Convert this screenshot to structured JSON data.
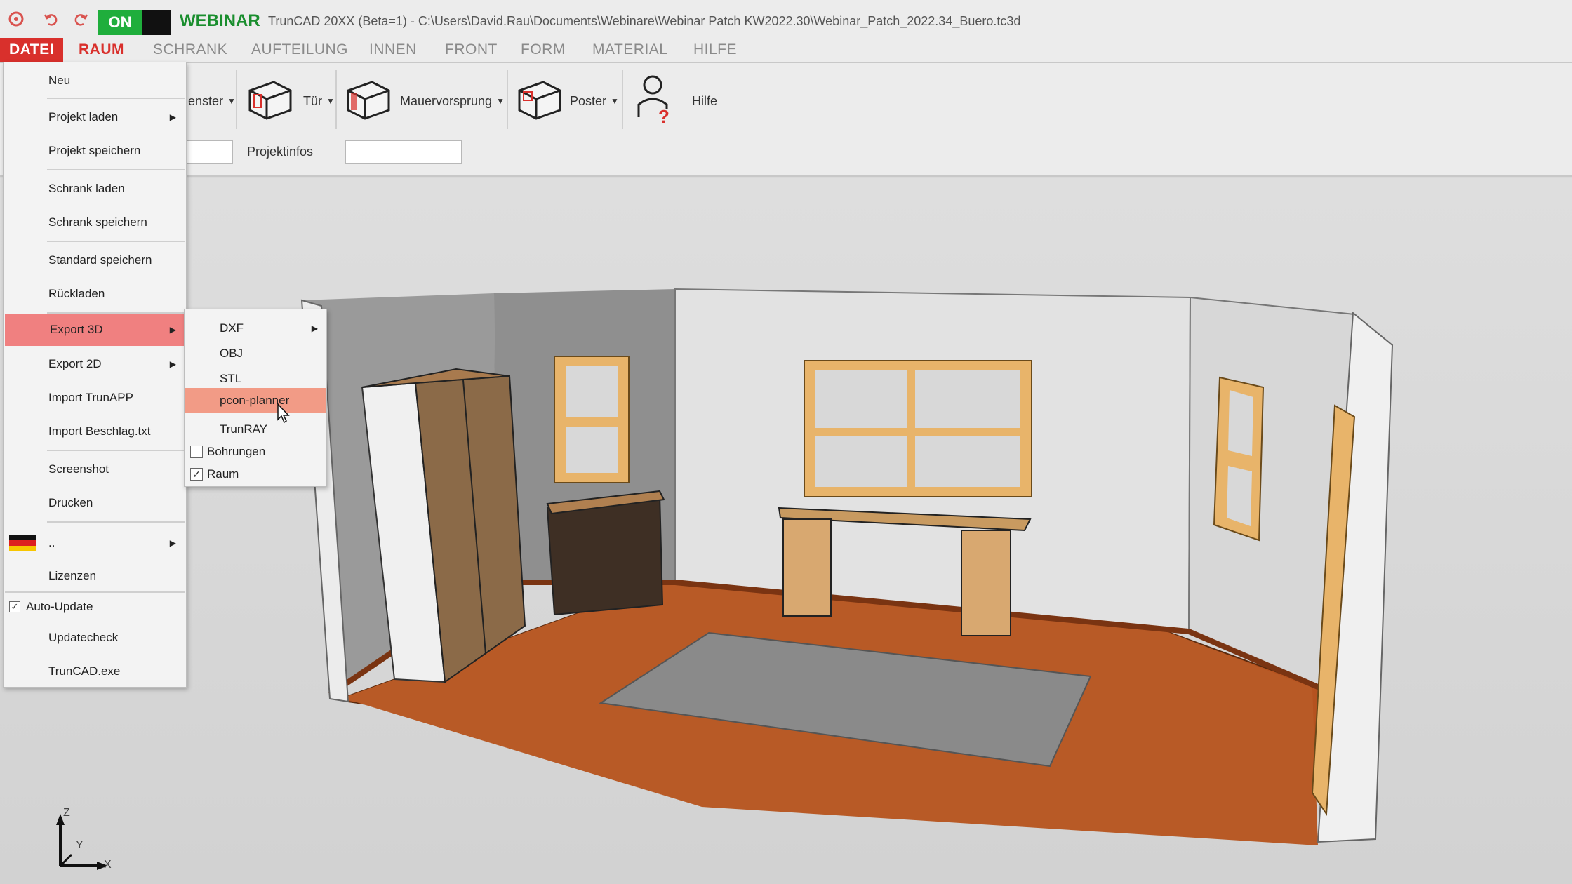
{
  "titlebar": {
    "on_label": "ON",
    "webinar_label": "WEBINAR",
    "window_title": "TrunCAD 20XX (Beta=1) - C:\\Users\\David.Rau\\Documents\\Webinare\\Webinar Patch KW2022.30\\Webinar_Patch_2022.34_Buero.tc3d",
    "icons": [
      "app-logo-icon",
      "undo-icon",
      "redo-icon"
    ]
  },
  "menubar": {
    "tabs": [
      "DATEI",
      "RAUM",
      "SCHRANK",
      "AUFTEILUNG",
      "INNEN",
      "FRONT",
      "FORM",
      "MATERIAL",
      "HILFE"
    ],
    "active": "DATEI"
  },
  "ribbon": {
    "fenster": "enster",
    "tuer": "Tür",
    "mauervorsprung": "Mauervorsprung",
    "poster": "Poster",
    "hilfe": "Hilfe",
    "projektinfos": "Projektinfos"
  },
  "file_menu": {
    "items": {
      "neu": "Neu",
      "projekt_laden": "Projekt laden",
      "projekt_speichern": "Projekt speichern",
      "schrank_laden": "Schrank laden",
      "schrank_speichern": "Schrank speichern",
      "standard_speichern": "Standard speichern",
      "rueckladen": "Rückladen",
      "export_3d": "Export 3D",
      "export_2d": "Export 2D",
      "import_trunapp": "Import TrunAPP",
      "import_beschlag": "Import Beschlag.txt",
      "screenshot": "Screenshot",
      "drucken": "Drucken",
      "language": "..",
      "lizenzen": "Lizenzen",
      "auto_update": "Auto-Update",
      "updatecheck": "Updatecheck",
      "truncad_exe": "TrunCAD.exe"
    },
    "auto_update_checked": true
  },
  "export3d_submenu": {
    "dxf": "DXF",
    "obj": "OBJ",
    "stl": "STL",
    "pcon": "pcon-planner",
    "trunray": "TrunRAY",
    "bohrungen": "Bohrungen",
    "raum": "Raum",
    "bohrungen_checked": false,
    "raum_checked": true
  },
  "axes": {
    "z": "Z",
    "y": "Y",
    "x": "X"
  },
  "colors": {
    "accent_red": "#d9302c",
    "on_green": "#1fae3c",
    "menu_highlight": "#f08080",
    "floor_wood": "#b5521f",
    "frame_wood": "#e8b46a"
  }
}
